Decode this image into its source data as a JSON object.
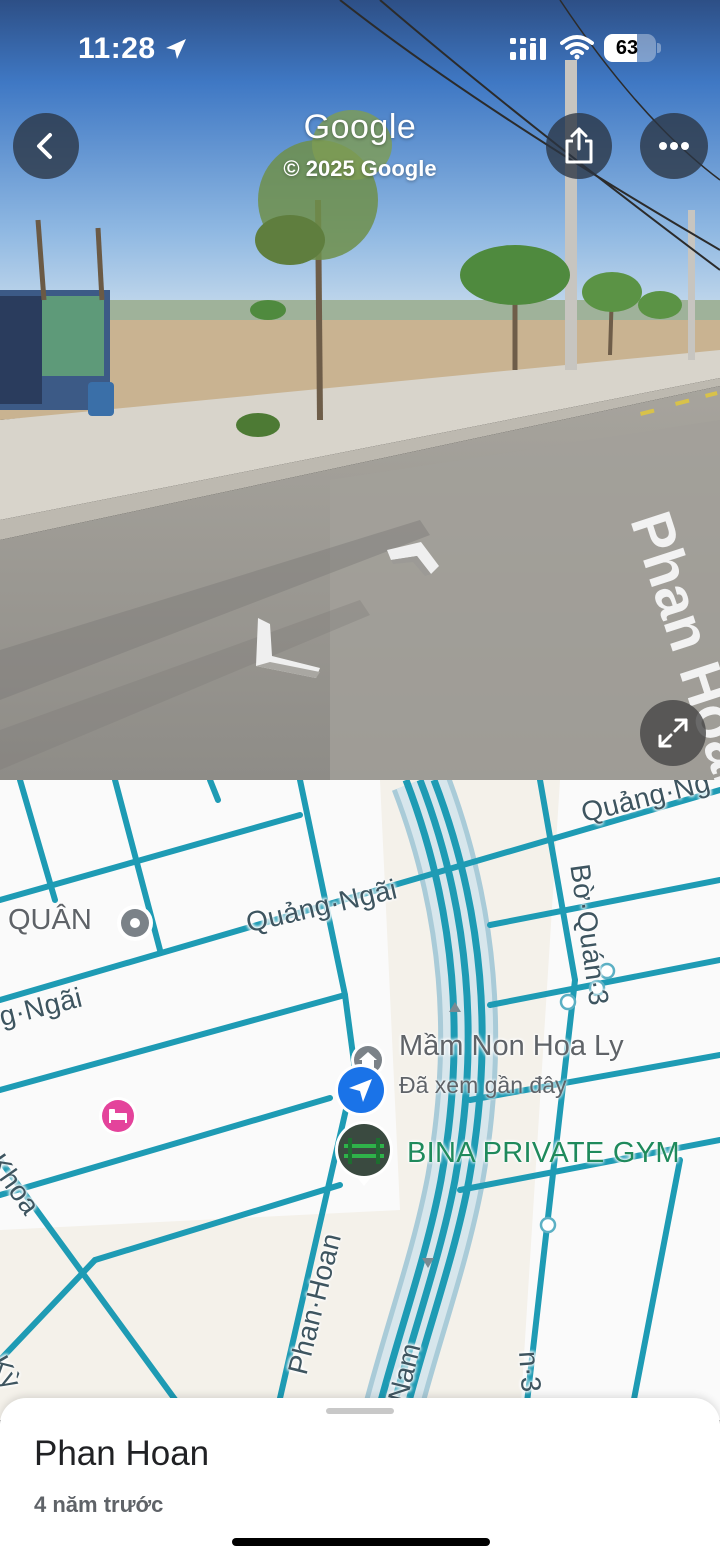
{
  "status_bar": {
    "time": "11:28",
    "battery": "63"
  },
  "street_view": {
    "title": "Google",
    "copyright": "© 2025 Google",
    "road_marking": "Phan Hoan"
  },
  "map": {
    "street_labels": {
      "quang_ngai_top_right": "Quảng·Ng",
      "quang_ngai_middle": "Quảng·Ngãi",
      "quang_ngai_left": "g·Ngãi",
      "bo_quan_3": "Bờ·Quán·3",
      "khoa": "Khoa",
      "phan_hoan": "Phan·Hoan",
      "nam": "Nam",
      "n3": "n·3",
      "h_ky": "h·Kỳ"
    },
    "poi_quan": "QUÂN",
    "poi_school": {
      "name": "Mầm Non Hoa Ly",
      "sub": "Đã xem gần đây"
    },
    "poi_gym": "BINA PRIVATE GYM"
  },
  "sheet": {
    "place_name": "Phan Hoan",
    "capture_age": "4 năm trước"
  },
  "icons": [
    "location-arrow-icon",
    "signal-icon",
    "wifi-icon",
    "battery-icon",
    "back-icon",
    "share-icon",
    "more-icon",
    "expand-icon",
    "nav-arrow-icon",
    "pin-icon",
    "school-icon",
    "hotel-icon",
    "current-location-icon"
  ],
  "colors": {
    "road": "#1e9bb4",
    "highway_casing": "#a9cbd8",
    "map_bg": "#f4f1ea",
    "gym_text": "#1f8a5c",
    "hotel_pin": "#e4439b",
    "location_blue": "#1a73e8"
  }
}
